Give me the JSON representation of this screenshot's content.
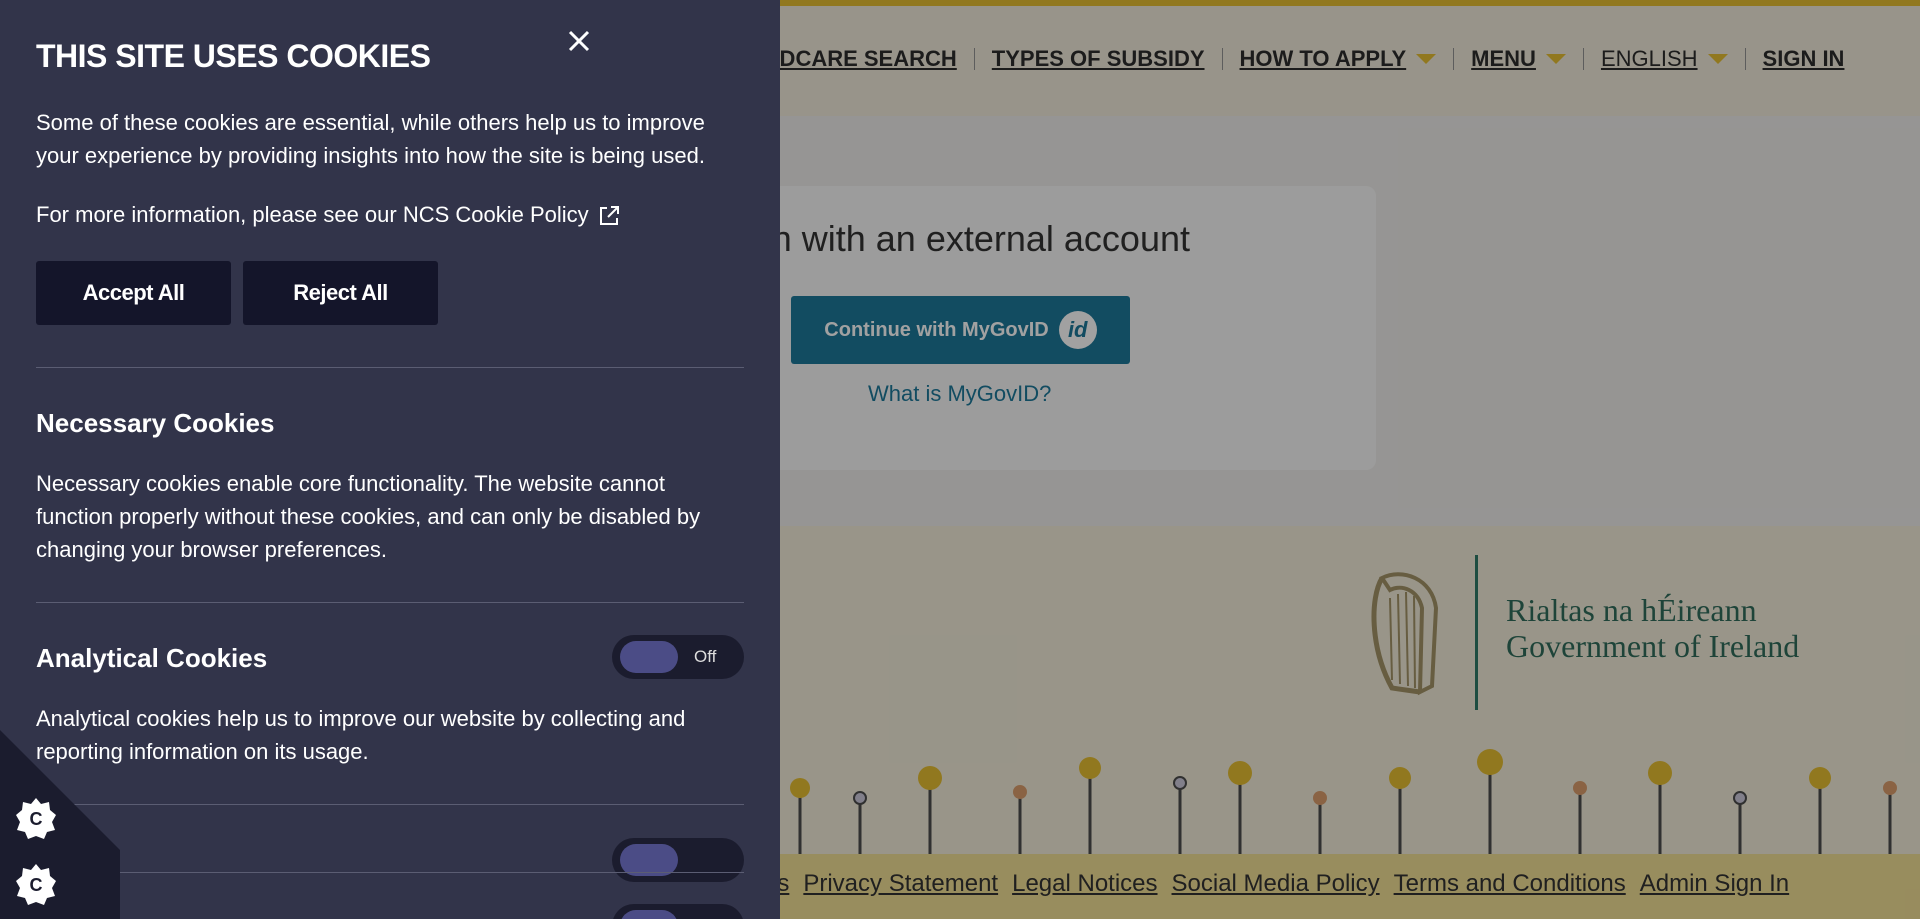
{
  "nav": {
    "items": [
      {
        "label": "ILDCARE SEARCH",
        "caret": false
      },
      {
        "label": "TYPES OF SUBSIDY",
        "caret": false
      },
      {
        "label": "HOW TO APPLY",
        "caret": true
      },
      {
        "label": "MENU",
        "caret": true
      },
      {
        "label": "ENGLISH",
        "caret": true
      },
      {
        "label": "SIGN IN",
        "caret": false
      }
    ]
  },
  "signin": {
    "title": "n in with an external account",
    "button_label": "Continue with MyGovID",
    "id_badge": "id",
    "what_link": "What is MyGovID?"
  },
  "gov": {
    "irish": "Rialtas na hÉireann",
    "english": "Government of Ireland"
  },
  "footer": {
    "links": [
      "Us",
      "Privacy Statement",
      "Legal Notices",
      "Social Media Policy",
      "Terms and Conditions",
      "Admin Sign In"
    ]
  },
  "cookie_panel": {
    "title": "THIS SITE USES COOKIES",
    "intro": "Some of these cookies are essential, while others help us to improve your experience by providing insights into how the site is being used.",
    "more_info": "For more information, please see our NCS Cookie Policy",
    "accept_label": "Accept All",
    "reject_label": "Reject All",
    "necessary": {
      "title": "Necessary Cookies",
      "text": "Necessary cookies enable core functionality. The website cannot function properly without these cookies, and can only be disabled by changing your browser preferences."
    },
    "analytical": {
      "title": "Analytical Cookies",
      "text": "Analytical cookies help us to improve our website by collecting and reporting information on its usage.",
      "toggle_label": "Off"
    }
  },
  "colors": {
    "panel_bg": "#32344a",
    "button_bg": "#14152a",
    "accent_yellow": "#e3b81f",
    "mygov_blue": "#0a6d92",
    "gov_green": "#1e5f4d"
  }
}
